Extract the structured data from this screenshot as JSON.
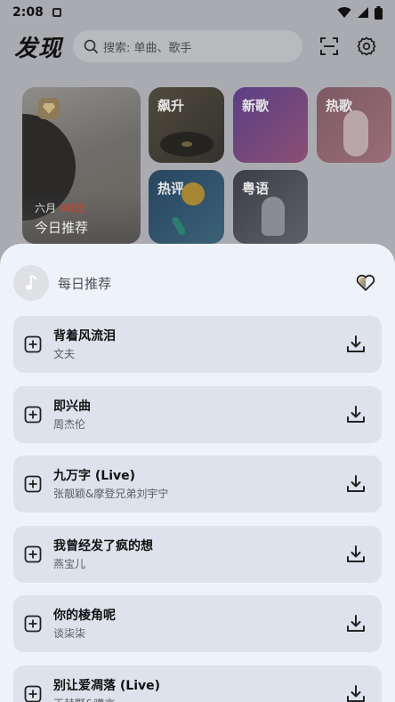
{
  "status_bar": {
    "time": "2:08"
  },
  "header": {
    "title": "发现",
    "search_placeholder": "搜索: 单曲、歌手"
  },
  "tiles": {
    "daily": {
      "month": "六月",
      "day": "08日",
      "label": "今日推荐"
    },
    "soaring": {
      "label": "飙升"
    },
    "new": {
      "label": "新歌"
    },
    "hot": {
      "label": "热歌"
    },
    "comment": {
      "label": "热评"
    },
    "cantonese": {
      "label": "粤语"
    }
  },
  "sheet": {
    "title": "每日推荐",
    "songs": [
      {
        "title": "背着风流泪",
        "artist": "文夫"
      },
      {
        "title": "即兴曲",
        "artist": "周杰伦"
      },
      {
        "title": "九万字 (Live)",
        "artist": "张靓颖&摩登兄弟刘宇宁"
      },
      {
        "title": "我曾经发了疯的想",
        "artist": "燕宝儿"
      },
      {
        "title": "你的棱角呢",
        "artist": "谈柒柒"
      },
      {
        "title": "别让爱凋落 (Live)",
        "artist": "王赫野&曦言"
      }
    ]
  },
  "colors": {
    "sheet_bg": "#eef2fb",
    "song_card_bg": "#dde2ec",
    "dim_overlay_bg": "#a9abb0",
    "date_red": "#b24a3a"
  }
}
